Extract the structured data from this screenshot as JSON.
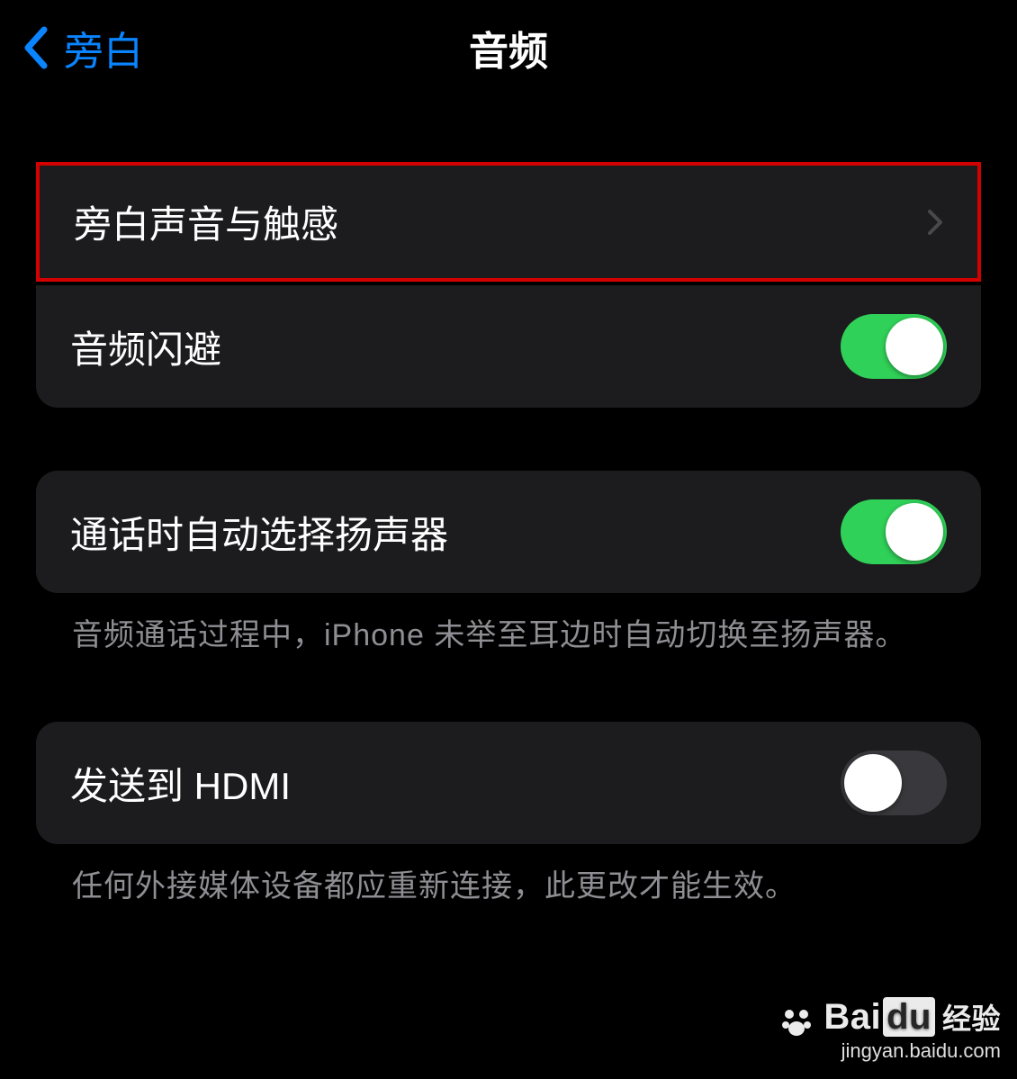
{
  "nav": {
    "back_label": "旁白",
    "title": "音频"
  },
  "group1": {
    "row1_label": "旁白声音与触感",
    "row2_label": "音频闪避",
    "row2_on": true
  },
  "group2": {
    "row1_label": "通话时自动选择扬声器",
    "row1_on": true,
    "footer": "音频通话过程中，iPhone 未举至耳边时自动切换至扬声器。"
  },
  "group3": {
    "row1_label": "发送到 HDMI",
    "row1_on": false,
    "footer": "任何外接媒体设备都应重新连接，此更改才能生效。"
  },
  "watermark": {
    "brand": "Bai",
    "brand2": "du",
    "suffix": "经验",
    "url": "jingyan.baidu.com"
  }
}
